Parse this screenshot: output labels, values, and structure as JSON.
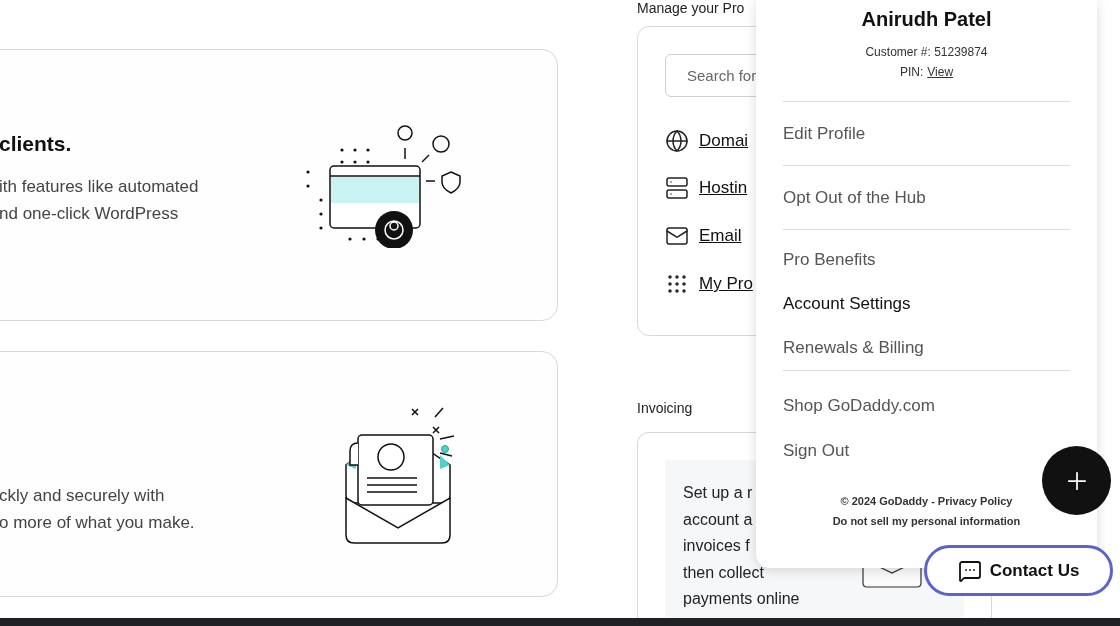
{
  "left_cards": [
    {
      "kind": "website",
      "heading": "clients.",
      "body_lines": [
        "ith features like automated",
        "nd one-click WordPress"
      ]
    },
    {
      "kind": "invoice",
      "body_lines": [
        "ckly and securely with",
        "o more of what you make."
      ]
    }
  ],
  "products": {
    "label": "Manage your Pro",
    "search": {
      "placeholder": "Search for"
    },
    "links": [
      {
        "kind": "globe",
        "label": "Domai"
      },
      {
        "kind": "server",
        "label": "Hostin"
      },
      {
        "kind": "mail",
        "label": "Email"
      },
      {
        "kind": "grid",
        "label": "My Pro"
      }
    ]
  },
  "invoicing": {
    "label": "Invoicing",
    "lines": [
      "Set up a r",
      "account a",
      "invoices f",
      "then collect",
      "payments online"
    ]
  },
  "account_menu": {
    "name": "Anirudh Patel",
    "customer_number": "Customer #: 51239874",
    "pin_label": "PIN:",
    "pin_link": "View",
    "groups": [
      [
        {
          "label": "Edit Profile",
          "highlighted": false
        }
      ],
      [
        {
          "label": "Opt Out of the Hub",
          "highlighted": false
        }
      ],
      [
        {
          "label": "Pro Benefits",
          "highlighted": false
        },
        {
          "label": "Account Settings",
          "highlighted": true
        },
        {
          "label": "Renewals & Billing",
          "highlighted": false
        }
      ],
      [
        {
          "label": "Shop GoDaddy.com",
          "highlighted": false
        },
        {
          "label": "Sign Out",
          "highlighted": false
        }
      ]
    ],
    "footer": {
      "copyright": "© 2024 GoDaddy - ",
      "privacy_link": "Privacy Policy",
      "do_not_sell": "Do not sell my personal information"
    }
  },
  "contact_button": {
    "label": "Contact Us"
  }
}
